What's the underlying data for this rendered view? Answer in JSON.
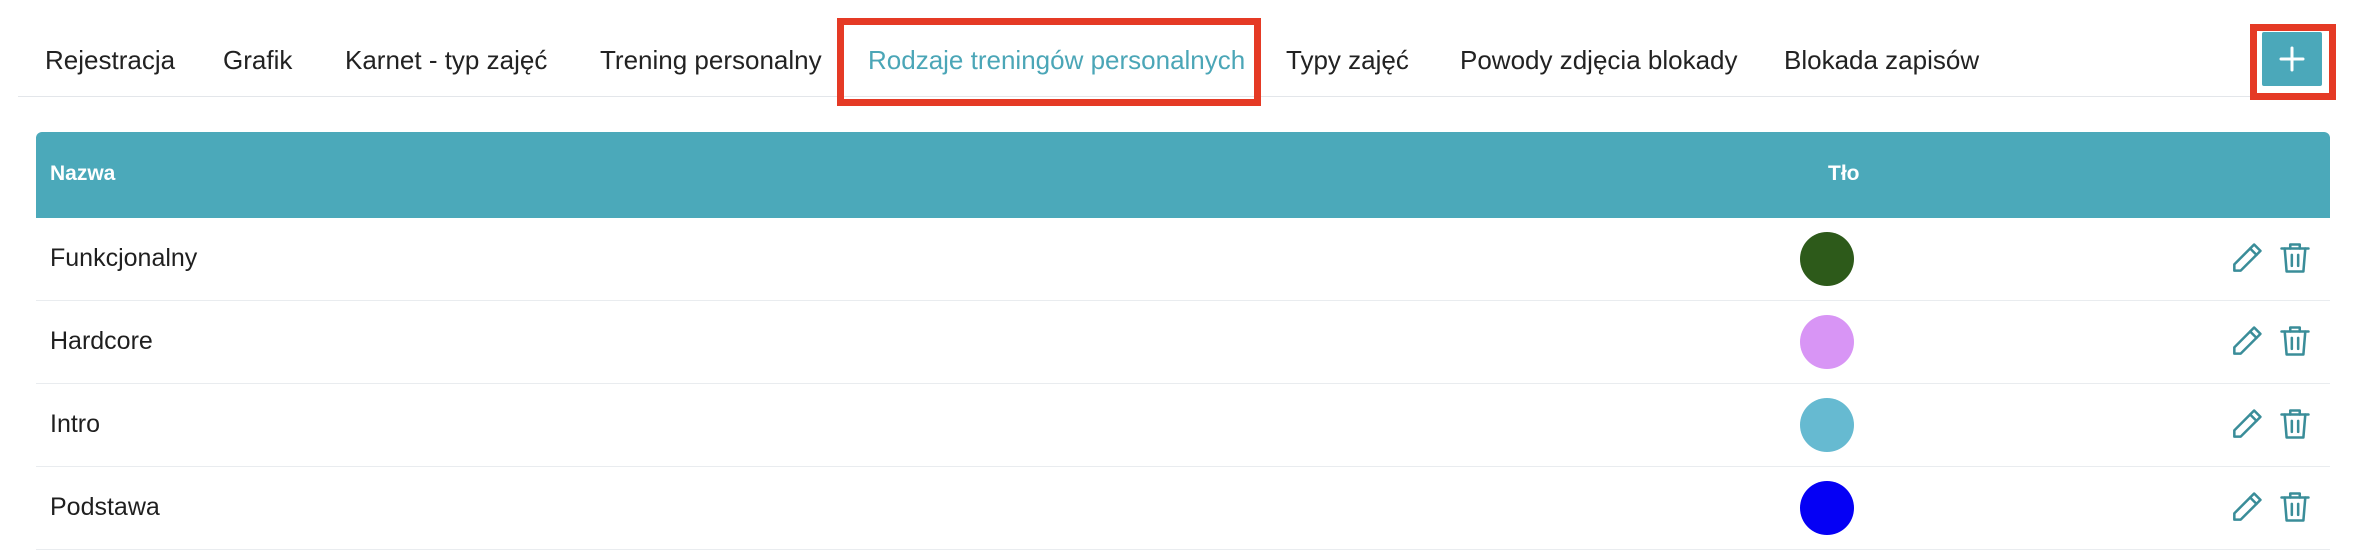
{
  "tabs": [
    {
      "label": "Rejestracja"
    },
    {
      "label": "Grafik"
    },
    {
      "label": "Karnet - typ zajęć"
    },
    {
      "label": "Trening personalny"
    },
    {
      "label": "Rodzaje treningów personalnych",
      "active": true
    },
    {
      "label": "Typy zajęć"
    },
    {
      "label": "Powody zdjęcia blokady"
    },
    {
      "label": "Blokada zapisów"
    }
  ],
  "add_button": {
    "icon": "plus-icon"
  },
  "table": {
    "headers": {
      "name": "Nazwa",
      "background": "Tło"
    },
    "rows": [
      {
        "name": "Funkcjonalny",
        "color": "#2d5a1a"
      },
      {
        "name": "Hardcore",
        "color": "#d895f5"
      },
      {
        "name": "Intro",
        "color": "#66bad1"
      },
      {
        "name": "Podstawa",
        "color": "#0500f5"
      }
    ],
    "row_actions": {
      "edit_icon": "pencil-icon",
      "delete_icon": "trash-icon"
    }
  },
  "colors": {
    "accent": "#4ba9ba",
    "highlight": "#e53a25"
  }
}
